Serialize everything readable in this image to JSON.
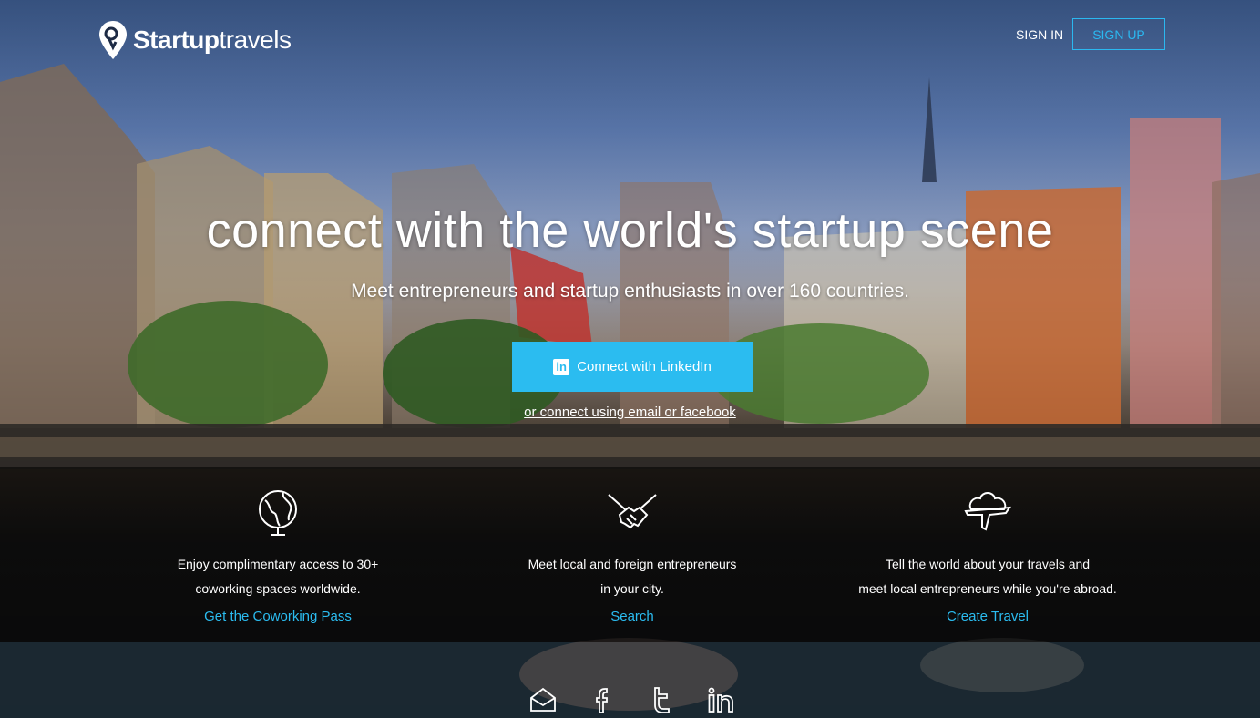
{
  "header": {
    "logo_bold": "Startup",
    "logo_light": "travels",
    "sign_in": "SIGN IN",
    "sign_up": "SIGN UP"
  },
  "hero": {
    "title": "connect with the world's startup scene",
    "subtitle": "Meet entrepreneurs and startup enthusiasts in over 160 countries.",
    "linkedin_button": "Connect with LinkedIn",
    "alt_link": "or connect using email or facebook"
  },
  "features": [
    {
      "icon": "globe-icon",
      "line1": "Enjoy complimentary access to 30+",
      "line2": "coworking spaces worldwide.",
      "link": "Get the Coworking Pass"
    },
    {
      "icon": "handshake-icon",
      "line1": "Meet local and foreign entrepreneurs",
      "line2": "in your city.",
      "link": "Search"
    },
    {
      "icon": "plane-icon",
      "line1": "Tell the world about your travels and",
      "line2": "meet local entrepreneurs while you're abroad.",
      "link": "Create Travel"
    }
  ],
  "social": [
    "mail-icon",
    "facebook-icon",
    "twitter-icon",
    "linkedin-icon"
  ],
  "colors": {
    "accent": "#2bbcf0"
  }
}
